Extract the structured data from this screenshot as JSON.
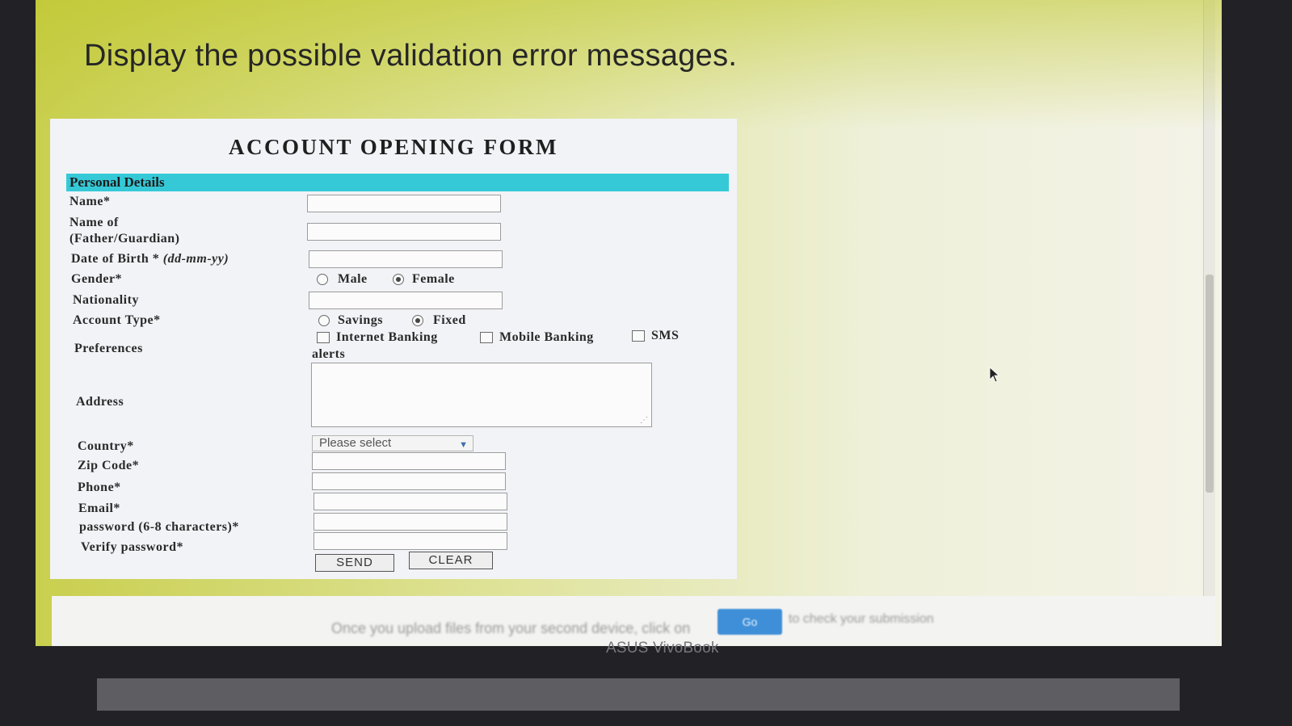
{
  "slide": {
    "title": "Display the possible validation error messages."
  },
  "form": {
    "title": "ACCOUNT OPENING FORM",
    "section_title": "Personal Details",
    "fields": {
      "name_label": "Name*",
      "father_label_1": "Name of",
      "father_label_2": "(Father/Guardian)",
      "dob_label": "Date of Birth *",
      "dob_hint": "(dd-mm-yy)",
      "gender_label": "Gender*",
      "gender_options": [
        "Male",
        "Female"
      ],
      "gender_selected": "Female",
      "nationality_label": "Nationality",
      "account_type_label": "Account Type*",
      "account_type_options": [
        "Savings",
        "Fixed"
      ],
      "account_type_selected": "Fixed",
      "preferences_label": "Preferences",
      "preferences_options": [
        "Internet Banking",
        "Mobile Banking",
        "SMS"
      ],
      "preferences_wrap": "alerts",
      "address_label": "Address",
      "country_label": "Country*",
      "country_value": "Please select",
      "zip_label": "Zip Code*",
      "phone_label": "Phone*",
      "email_label": "Email*",
      "password_label": "password (6-8 characters)*",
      "verify_label": "Verify password*"
    },
    "buttons": {
      "send": "SEND",
      "clear": "CLEAR"
    }
  },
  "footer": {
    "text": "Once you upload files from your second device, click on",
    "button": "Go",
    "text_after": "to check your submission"
  },
  "laptop": {
    "brand": "ASUS VivoBook"
  },
  "colors": {
    "section_bar": "#35c9d8",
    "slide_background": "#c9cf4e",
    "form_background": "#f2f3f7"
  }
}
